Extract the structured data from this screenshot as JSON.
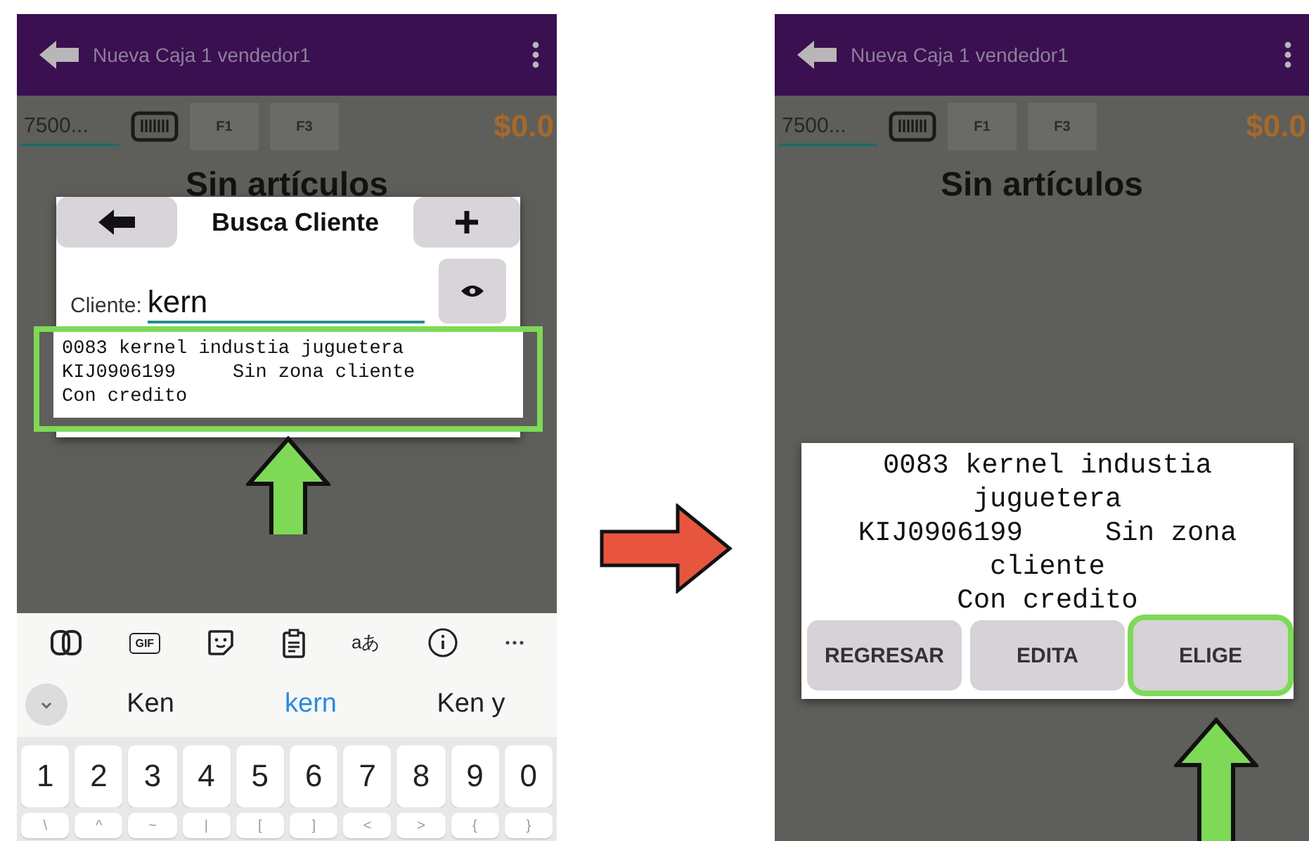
{
  "screens": [
    {
      "kind": "search",
      "app_bar": {
        "title": "Nueva Caja 1 vendedor1"
      },
      "toolbar": {
        "code_field": {
          "placeholder": "7500..."
        },
        "keys": [
          "F1",
          "F3"
        ],
        "total": "$0.0"
      },
      "heading": "Sin artículos",
      "dialog": {
        "title": "Busca Cliente",
        "field_label": "Cliente:",
        "field_value": "kern",
        "highlighted": true,
        "result_lines": [
          "0083 kernel industia juguetera",
          "KIJ0906199     Sin zona cliente",
          "Con credito"
        ]
      },
      "keyboard": {
        "gif_label": "GIF",
        "translate_label": "aあ",
        "suggestions": [
          {
            "text": "Ken",
            "selected": false
          },
          {
            "text": "kern",
            "selected": true
          },
          {
            "text": "Ken y",
            "selected": false
          }
        ],
        "number_keys": [
          "1",
          "2",
          "3",
          "4",
          "5",
          "6",
          "7",
          "8",
          "9",
          "0"
        ],
        "symbol_keys": [
          "\\",
          "^",
          "~",
          "|",
          "[",
          "]",
          "<",
          ">",
          "{",
          "}"
        ]
      }
    },
    {
      "kind": "confirm",
      "app_bar": {
        "title": "Nueva Caja 1 vendedor1"
      },
      "toolbar": {
        "code_field": {
          "placeholder": "7500..."
        },
        "keys": [
          "F1",
          "F3"
        ],
        "total": "$0.0"
      },
      "heading": "Sin artículos",
      "dialog": {
        "result_lines": [
          "0083 kernel industia juguetera",
          "KIJ0906199     Sin zona cliente",
          "Con credito"
        ],
        "buttons": [
          {
            "label": "REGRESAR",
            "highlighted": false
          },
          {
            "label": "EDITA",
            "highlighted": false
          },
          {
            "label": "ELIGE",
            "highlighted": true
          }
        ]
      }
    }
  ]
}
